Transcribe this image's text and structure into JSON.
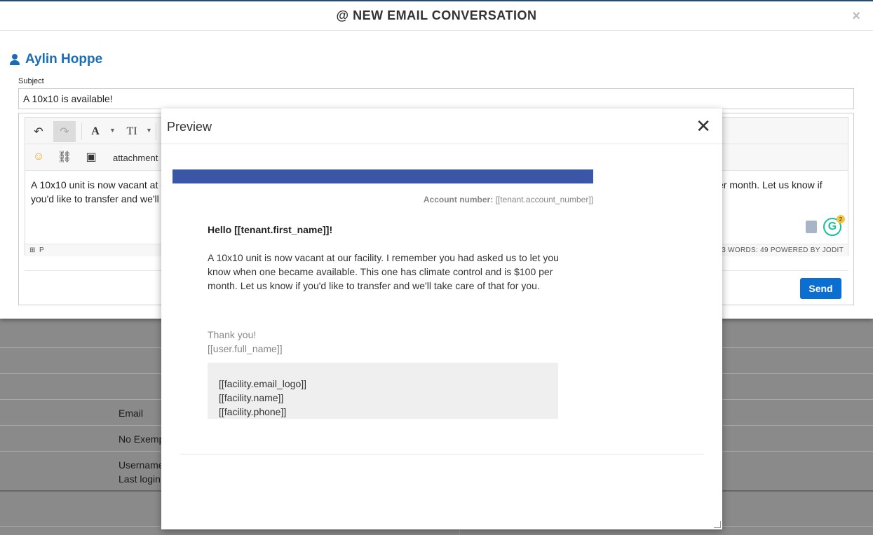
{
  "modal": {
    "title": "@ NEW EMAIL CONVERSATION",
    "close_glyph": "×"
  },
  "contact": {
    "name": "Aylin Hoppe"
  },
  "subject": {
    "label": "Subject",
    "value": "A 10x10 is available!"
  },
  "editor": {
    "toolbar": {
      "undo": "↶",
      "redo": "↷",
      "font": "A",
      "size": "TI",
      "emoji": "☺",
      "link": "⛓",
      "image": "▣",
      "attachment": "attachment"
    },
    "text_line1_left": "A 10x10 unit is now vacant at o",
    "text_line2_left": "you'd like to transfer and we'll t",
    "text_line1_right": "er month. Let us know if",
    "status_path": "P",
    "status_right": "3  WORDS: 49  POWERED BY JODIT",
    "grammarly_letter": "G",
    "grammarly_count": "2"
  },
  "send_label": "Send",
  "background": {
    "labels": [
      "Email",
      "No Exemp",
      "Username",
      "Last login:"
    ]
  },
  "preview": {
    "title": "Preview",
    "close_glyph": "✕",
    "account_label": "Account number:",
    "account_value": "[[tenant.account_number]]",
    "greeting": "Hello [[tenant.first_name]]!",
    "body": "A 10x10 unit is now vacant at our facility. I remember you had asked us to let you know when one became available. This one has climate control and is $100 per month. Let us know if you'd like to transfer and we'll take care of that for you.",
    "thanks": "Thank you!",
    "signature": "[[user.full_name]]",
    "footer": [
      "[[facility.email_logo]]",
      "[[facility.name]]",
      "[[facility.phone]]"
    ]
  },
  "colors": {
    "accent": "#1a6db5",
    "send": "#0a6fd0",
    "email_bar": "#3a56a4"
  }
}
